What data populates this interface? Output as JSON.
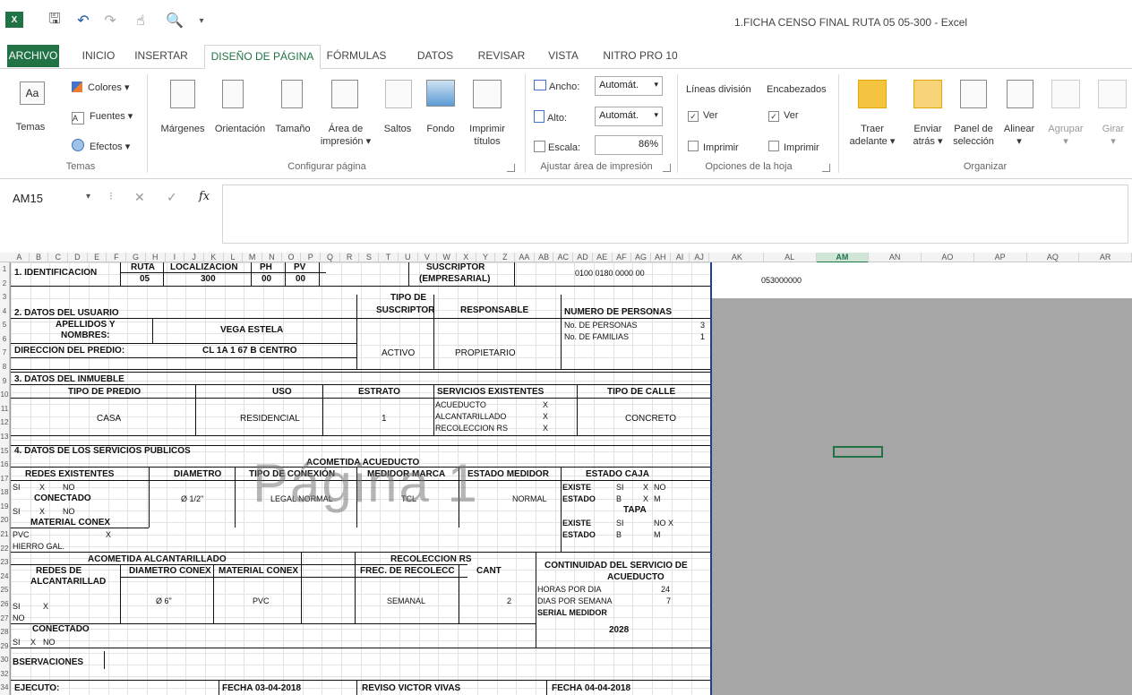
{
  "window": {
    "title": "1.FICHA CENSO FINAL RUTA 05 05-300 - Excel"
  },
  "tabs": [
    "ARCHIVO",
    "INICIO",
    "INSERTAR",
    "DISEÑO DE PÁGINA",
    "FÓRMULAS",
    "DATOS",
    "REVISAR",
    "VISTA",
    "NITRO PRO 10"
  ],
  "ribbon": {
    "temas": {
      "temas_label": "Temas",
      "colores": "Colores",
      "fuentes": "Fuentes",
      "efectos": "Efectos",
      "group": "Temas"
    },
    "config": {
      "margenes": "Márgenes",
      "orientacion": "Orientación",
      "tamano": "Tamaño",
      "area1": "Área de",
      "area2": "impresión",
      "saltos": "Saltos",
      "fondo": "Fondo",
      "imprimir1": "Imprimir",
      "imprimir2": "títulos",
      "group": "Configurar página"
    },
    "ajustar": {
      "ancho": "Ancho:",
      "ancho_val": "Automát.",
      "alto": "Alto:",
      "alto_val": "Automát.",
      "escala": "Escala:",
      "escala_val": "86%",
      "group": "Ajustar área de impresión"
    },
    "opciones": {
      "lineas": "Líneas división",
      "encabezados": "Encabezados",
      "ver": "Ver",
      "imprimir": "Imprimir",
      "group": "Opciones de la hoja"
    },
    "organizar": {
      "traer1": "Traer",
      "traer2": "adelante",
      "enviar1": "Enviar",
      "enviar2": "atrás",
      "panel1": "Panel de",
      "panel2": "selección",
      "alinear": "Alinear",
      "agrupar": "Agrupar",
      "girar": "Girar",
      "group": "Organizar"
    }
  },
  "formula": {
    "namebox": "AM15",
    "fx": "fx"
  },
  "columns": [
    "A",
    "B",
    "C",
    "D",
    "E",
    "F",
    "G",
    "H",
    "I",
    "J",
    "K",
    "L",
    "M",
    "N",
    "O",
    "P",
    "Q",
    "R",
    "S",
    "T",
    "U",
    "V",
    "W",
    "X",
    "Y",
    "Z",
    "AA",
    "AB",
    "AC",
    "AD",
    "AE",
    "AF",
    "AG",
    "AH",
    "AI",
    "AJ",
    "AK",
    "AL",
    "AM",
    "AN",
    "AO",
    "AP",
    "AQ",
    "AR"
  ],
  "rows": [
    "1",
    "2",
    "3",
    "4",
    "5",
    "6",
    "7",
    "8",
    "9",
    "10",
    "11",
    "12",
    "13",
    "15",
    "16",
    "17",
    "18",
    "19",
    "20",
    "21",
    "22",
    "23",
    "24",
    "25",
    "26",
    "27",
    "28",
    "29",
    "30",
    "32",
    "34"
  ],
  "side_value": "053000000",
  "watermark": "Página 1",
  "form": {
    "identificacion": "1. IDENTIFICACION",
    "ruta": "RUTA",
    "ruta_v": "05",
    "localizacion": "LOCALIZACION",
    "loc_v": "300",
    "ph": "PH",
    "ph_v": "00",
    "pv": "PV",
    "pv_v": "00",
    "suscriptor": "SUSCRIPTOR",
    "empresarial": "(EMPRESARIAL)",
    "codigo": "0100 0180 0000 00",
    "datos_usuario": "2. DATOS DEL USUARIO",
    "tipo_de": "TIPO DE",
    "suscriptor2": "SUSCRIPTOR",
    "responsable": "RESPONSABLE",
    "num_personas": "NUMERO DE PERSONAS",
    "apellidos": "APELLIDOS Y",
    "nombres": "NOMBRES:",
    "nombre_v": "VEGA ESTELA",
    "activo": "ACTIVO",
    "propietario": "PROPIETARIO",
    "no_personas": "No. DE PERSONAS",
    "no_personas_v": "3",
    "no_familias": "No. DE FAMILIAS",
    "no_familias_v": "1",
    "direccion": "DIRECCION DEL PREDIO:",
    "direccion_v": "CL 1A  1 67 B CENTRO",
    "inmueble": "3. DATOS DEL INMUEBLE",
    "tipo_predio": "TIPO DE PREDIO",
    "uso": "USO",
    "estrato": "ESTRATO",
    "servicios": "SERVICIOS EXISTENTES",
    "tipo_calle": "TIPO DE CALLE",
    "casa": "CASA",
    "residencial": "RESIDENCIAL",
    "estrato_v": "1",
    "acueducto": "ACUEDUCTO",
    "alcantarillado": "ALCANTARILLADO",
    "recoleccion": "RECOLECCION RS",
    "x": "X",
    "concreto": "CONCRETO",
    "servicios_pub": "4. DATOS DE LOS SERVICIOS PUBLICOS",
    "acometida_acu": "ACOMETIDA ACUEDUCTO",
    "redes": "REDES EXISTENTES",
    "diametro": "DIAMETRO",
    "tipo_conexion": "TIPO DE CONEXIÓN",
    "medidor_marca": "MEDIDOR MARCA",
    "estado_medidor": "ESTADO MEDIDOR",
    "estado_caja": "ESTADO CAJA",
    "si": "SI",
    "no": "NO",
    "conectado": "CONECTADO",
    "d12": "Ø 1/2\"",
    "legal": "LEGAL NORMAL",
    "tcl": "TCL",
    "normal": "NORMAL",
    "existe": "EXISTE",
    "estado": "ESTADO",
    "b": "B",
    "m": "M",
    "tapa": "TAPA",
    "material": "MATERIAL CONEX",
    "pvc": "PVC",
    "hierro": "HIERRO GAL.",
    "acometida_alc": "ACOMETIDA ALCANTARILLADO",
    "recoleccion_rs": "RECOLECCION RS",
    "continuidad1": "CONTINUIDAD DEL SERVICIO DE",
    "continuidad2": "ACUEDUCTO",
    "redes_de": "REDES DE",
    "alcantarillad": "ALCANTARILLAD",
    "diametro_conex": "DIAMETRO CONEX",
    "material_conex": "MATERIAL CONEX",
    "frec": "FREC. DE RECOLECC",
    "cant": "CANT",
    "horas": "HORAS POR DIA",
    "horas_v": "24",
    "dias": "DIAS POR SEMANA",
    "dias_v": "7",
    "serial": "SERIAL MEDIDOR",
    "serial_v": "2028",
    "d6": "Ø 6\"",
    "semanal": "SEMANAL",
    "cant_v": "2",
    "observaciones": "BSERVACIONES",
    "ejecuto": "EJECUTO:",
    "fecha1": "FECHA 03-04-2018",
    "reviso": "REVISO  VICTOR VIVAS",
    "fecha2": "FECHA  04-04-2018"
  }
}
